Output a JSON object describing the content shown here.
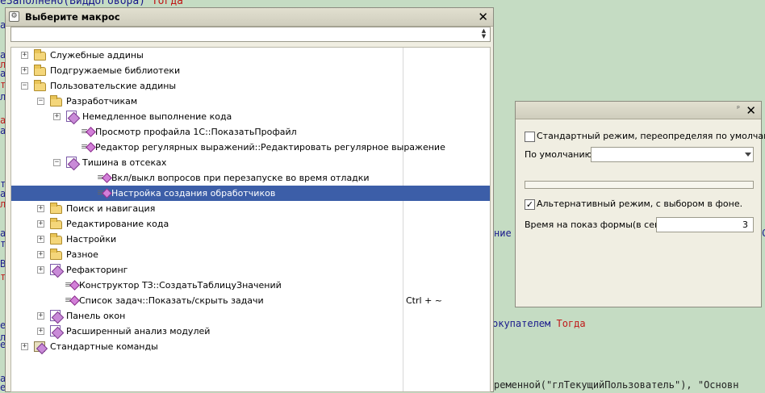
{
  "background_code": {
    "line_top": "еЗаполнено(ВидДоговора) ",
    "line_top_kw": "Тогда",
    "right_fragment_1": "ние",
    "right_fragment_1_end": "С",
    "right_fragment_2": "окупателем ",
    "right_fragment_2_kw": "Тогда",
    "right_fragment_3": "ременной(\"глТекущийПользователь\"), \"Основн",
    "right_fragment_3_kw": "ременной(",
    "left_fragments": [
      "а",
      "а",
      "л",
      "а",
      "т",
      "л",
      "а",
      "а",
      "т",
      "а",
      "л",
      "а",
      "т",
      "В",
      "т",
      "е",
      "л",
      "е",
      "а",
      "е"
    ]
  },
  "dialog": {
    "title": "Выберите макрос",
    "search_value": "",
    "close_label": "✕"
  },
  "tree": [
    {
      "label": "Служебные аддины",
      "level": 0,
      "exp": "+",
      "icon": "folder",
      "shortcut": ""
    },
    {
      "label": "Подгружаемые библиотеки",
      "level": 0,
      "exp": "+",
      "icon": "folder",
      "shortcut": ""
    },
    {
      "label": "Пользовательские аддины",
      "level": 0,
      "exp": "−",
      "icon": "folder",
      "shortcut": ""
    },
    {
      "label": "Разработчикам",
      "level": 1,
      "exp": "−",
      "icon": "folder",
      "shortcut": ""
    },
    {
      "label": "Немедленное выполнение кода",
      "level": 2,
      "exp": "+",
      "icon": "book",
      "shortcut": ""
    },
    {
      "label": "Просмотр профайла 1С::ПоказатьПрофайл",
      "level": 2,
      "exp": "",
      "icon": "macro",
      "shortcut": ""
    },
    {
      "label": "Редактор регулярных выражений::Редактировать регулярное выражение",
      "level": 2,
      "exp": "",
      "icon": "macro",
      "shortcut": ""
    },
    {
      "label": "Тишина в отсеках",
      "level": 2,
      "exp": "−",
      "icon": "book",
      "shortcut": ""
    },
    {
      "label": "Вкл/выкл вопросов при перезапуске во время отладки",
      "level": 3,
      "exp": "",
      "icon": "macro",
      "shortcut": ""
    },
    {
      "label": "Настройка создания обработчиков",
      "level": 3,
      "exp": "",
      "icon": "macro",
      "shortcut": "",
      "selected": true
    },
    {
      "label": "Поиск и навигация",
      "level": 1,
      "exp": "+",
      "icon": "folder",
      "shortcut": ""
    },
    {
      "label": "Редактирование кода",
      "level": 1,
      "exp": "+",
      "icon": "folder",
      "shortcut": ""
    },
    {
      "label": "Настройки",
      "level": 1,
      "exp": "+",
      "icon": "folder",
      "shortcut": ""
    },
    {
      "label": "Разное",
      "level": 1,
      "exp": "+",
      "icon": "folder",
      "shortcut": ""
    },
    {
      "label": "Рефакторинг",
      "level": 1,
      "exp": "+",
      "icon": "book",
      "shortcut": ""
    },
    {
      "label": "Конструктор ТЗ::СоздатьТаблицуЗначений",
      "level": 1,
      "exp": "",
      "icon": "macro",
      "shortcut": ""
    },
    {
      "label": "Список задач::Показать/скрыть задачи",
      "level": 1,
      "exp": "",
      "icon": "macro",
      "shortcut": "Ctrl + ~"
    },
    {
      "label": "Панель окон",
      "level": 1,
      "exp": "+",
      "icon": "book",
      "shortcut": ""
    },
    {
      "label": "Расширенный анализ модулей",
      "level": 1,
      "exp": "+",
      "icon": "book",
      "shortcut": ""
    },
    {
      "label": "Стандартные команды",
      "level": 0,
      "exp": "+",
      "icon": "cmdset",
      "shortcut": ""
    }
  ],
  "settings_panel": {
    "pin_label": "ᵖ",
    "close_label": "✕",
    "standard_mode_label": "Стандартный режим, переопределяя по умолчанию",
    "standard_mode_checked": false,
    "default_label": "По умолчанию:",
    "default_value": "",
    "alt_mode_label": "Альтернативный режим, с выбором в фоне.",
    "alt_mode_checked": true,
    "display_time_label": "Время на показ формы(в сек):",
    "display_time_value": "3"
  }
}
